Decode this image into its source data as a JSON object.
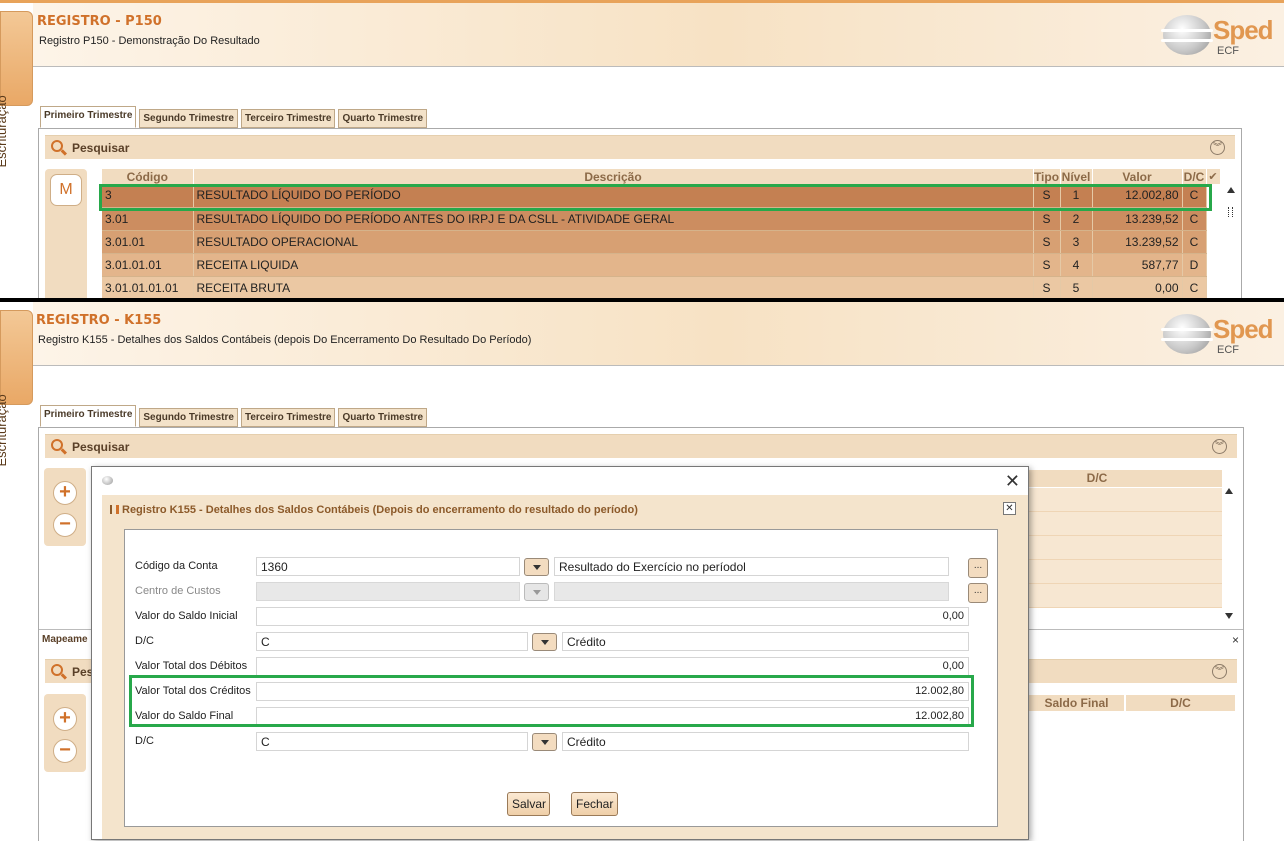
{
  "top": {
    "side_tab": "Escrituração",
    "title": "REGISTRO - P150",
    "subtitle": "Registro P150 - Demonstração Do Resultado",
    "logo": {
      "word": "Sped",
      "sub": "ECF"
    },
    "tabs": [
      "Primeiro Trimestre",
      "Segundo Trimestre",
      "Terceiro Trimestre",
      "Quarto Trimestre"
    ],
    "search_label": "Pesquisar",
    "m_button": "M",
    "columns": [
      "Código",
      "Descrição",
      "Tipo",
      "Nível",
      "Valor",
      "D/C"
    ],
    "rows": [
      {
        "codigo": "3",
        "descricao": "RESULTADO LÍQUIDO DO PERÍODO",
        "tipo": "S",
        "nivel": "1",
        "valor": "12.002,80",
        "dc": "C"
      },
      {
        "codigo": "3.01",
        "descricao": "RESULTADO LÍQUIDO DO PERÍODO ANTES DO IRPJ E DA CSLL - ATIVIDADE GERAL",
        "tipo": "S",
        "nivel": "2",
        "valor": "13.239,52",
        "dc": "C"
      },
      {
        "codigo": "3.01.01",
        "descricao": "RESULTADO OPERACIONAL",
        "tipo": "S",
        "nivel": "3",
        "valor": "13.239,52",
        "dc": "C"
      },
      {
        "codigo": "3.01.01.01",
        "descricao": "RECEITA LIQUIDA",
        "tipo": "S",
        "nivel": "4",
        "valor": "587,77",
        "dc": "D"
      },
      {
        "codigo": "3.01.01.01.01",
        "descricao": "RECEITA BRUTA",
        "tipo": "S",
        "nivel": "5",
        "valor": "0,00",
        "dc": "C"
      }
    ]
  },
  "bottom": {
    "side_tab": "Escrituração",
    "title": "REGISTRO - K155",
    "subtitle": "Registro K155 - Detalhes dos Saldos Contábeis (depois Do Encerramento Do Resultado Do Período)",
    "logo": {
      "word": "Sped",
      "sub": "ECF"
    },
    "tabs": [
      "Primeiro Trimestre",
      "Segundo Trimestre",
      "Terceiro Trimestre",
      "Quarto Trimestre"
    ],
    "search_label": "Pesquisar",
    "search_label_2": "Pes",
    "grid_dc_header": "D/C",
    "mapeamento_label": "Mapeame",
    "lower_columns": [
      "Saldo Final",
      "D/C"
    ],
    "close_small": "×"
  },
  "dialog": {
    "title": "Registro K155 - Detalhes dos Saldos Contábeis (Depois do encerramento do resultado do período)",
    "fields": {
      "codigo_conta": {
        "label": "Código da Conta",
        "value": "1360",
        "desc": "Resultado do Exercício no períodol"
      },
      "centro_custos": {
        "label": "Centro de Custos",
        "value": "",
        "desc": ""
      },
      "saldo_inicial": {
        "label": "Valor do Saldo Inicial",
        "value": "0,00"
      },
      "dc_inicial": {
        "label": "D/C",
        "value": "C",
        "desc": "Crédito"
      },
      "total_debitos": {
        "label": "Valor Total dos Débitos",
        "value": "0,00"
      },
      "total_creditos": {
        "label": "Valor Total dos Créditos",
        "value": "12.002,80"
      },
      "saldo_final": {
        "label": "Valor do Saldo Final",
        "value": "12.002,80"
      },
      "dc_final": {
        "label": "D/C",
        "value": "C",
        "desc": "Crédito"
      }
    },
    "ellipsis": "...",
    "buttons": {
      "save": "Salvar",
      "close": "Fechar"
    }
  },
  "colors": {
    "accent": "#d0712a",
    "highlight": "#27a84a",
    "header_bg": "#f1dcc0"
  }
}
